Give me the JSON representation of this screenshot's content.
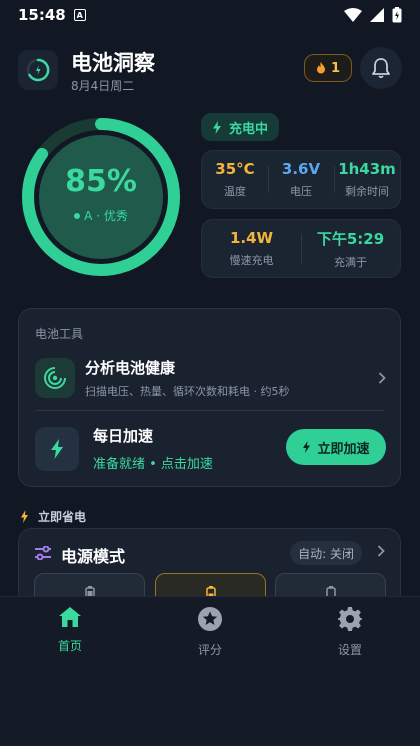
{
  "status_bar": {
    "time": "15:48",
    "notification_glyph": "A"
  },
  "header": {
    "title": "电池洞察",
    "date": "8月4日周二",
    "streak_count": "1"
  },
  "battery": {
    "percent_label": "85%",
    "percent_value": 85,
    "grade": "A · 优秀",
    "charging_status": "充电中",
    "accent_color": "#3ad9a0"
  },
  "stats": {
    "temperature": {
      "value": "35°C",
      "label": "温度",
      "color": "#f5b43a"
    },
    "voltage": {
      "value": "3.6V",
      "label": "电压",
      "color": "#5aa8f0"
    },
    "remaining": {
      "value": "1h43m",
      "label": "剩余时间",
      "color": "#3ad9a0"
    },
    "power": {
      "value": "1.4W",
      "label": "慢速充电",
      "color": "#f5b43a"
    },
    "full_at": {
      "value": "下午5:29",
      "label": "充满于",
      "color": "#3ad9a0"
    }
  },
  "tools": {
    "section_title": "电池工具",
    "analyze": {
      "title": "分析电池健康",
      "description": "扫描电压、热量、循环次数和耗电 · 约5秒"
    },
    "boost": {
      "title": "每日加速",
      "status": "准备就绪 • 点击加速",
      "button_label": "立即加速"
    }
  },
  "save": {
    "section_title": "立即省电",
    "power_mode": {
      "title": "电源模式",
      "auto_label": "自动: 关闭"
    }
  },
  "bottom_nav": [
    {
      "label": "首页",
      "icon": "home-icon",
      "active": true
    },
    {
      "label": "评分",
      "icon": "star-icon",
      "active": false
    },
    {
      "label": "设置",
      "icon": "gear-icon",
      "active": false
    }
  ]
}
